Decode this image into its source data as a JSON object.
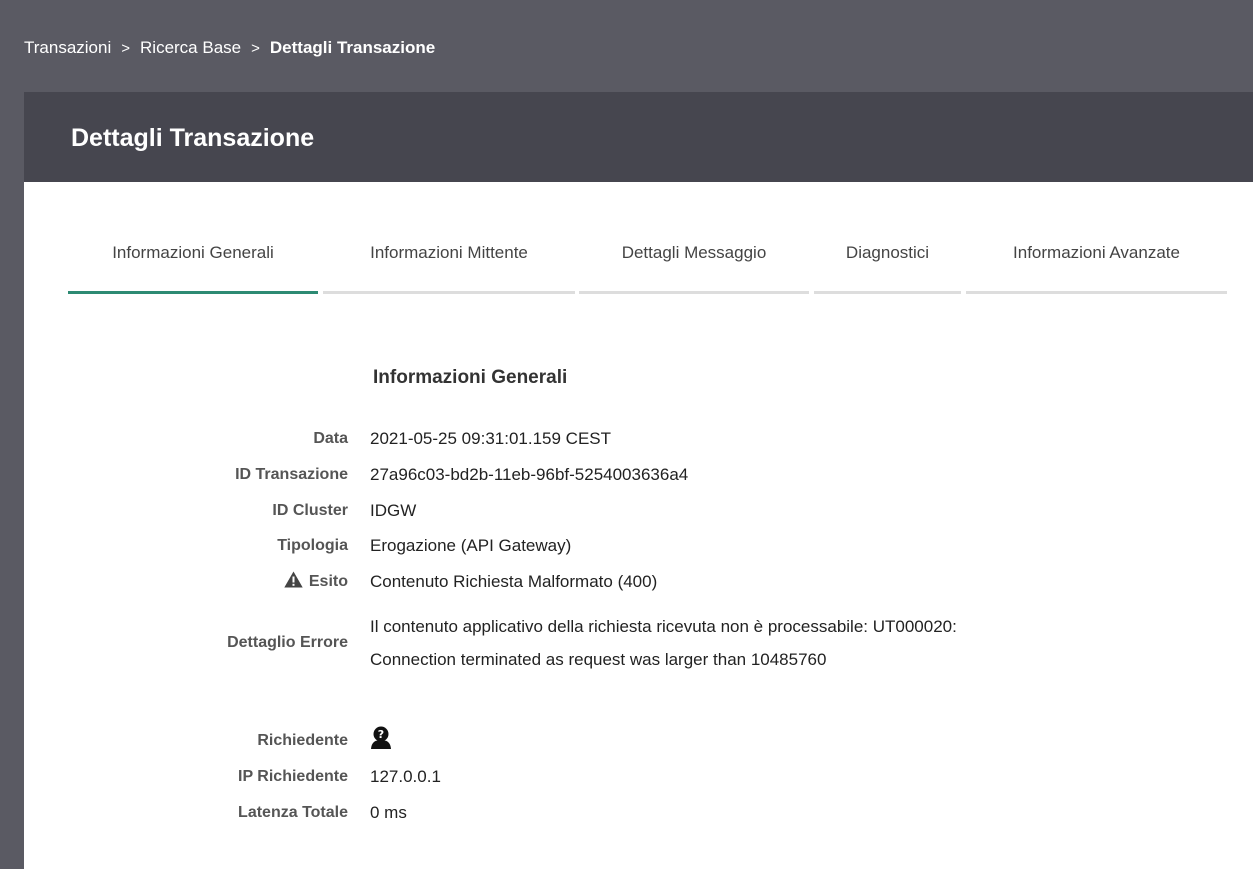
{
  "breadcrumb": {
    "items": [
      "Transazioni",
      "Ricerca Base"
    ],
    "current": "Dettagli Transazione",
    "separator": ">"
  },
  "panel": {
    "title": "Dettagli Transazione"
  },
  "tabs": [
    {
      "label": "Informazioni Generali",
      "active": true
    },
    {
      "label": "Informazioni Mittente",
      "active": false
    },
    {
      "label": "Dettagli Messaggio",
      "active": false
    },
    {
      "label": "Diagnostici",
      "active": false
    },
    {
      "label": "Informazioni Avanzate",
      "active": false
    }
  ],
  "section": {
    "title": "Informazioni Generali",
    "fields": {
      "data": {
        "label": "Data",
        "value": "2021-05-25 09:31:01.159 CEST"
      },
      "id_transazione": {
        "label": "ID Transazione",
        "value": "27a96c03-bd2b-11eb-96bf-5254003636a4"
      },
      "id_cluster": {
        "label": "ID Cluster",
        "value": "IDGW"
      },
      "tipologia": {
        "label": "Tipologia",
        "value": "Erogazione (API Gateway)"
      },
      "esito": {
        "label": "Esito",
        "value": "Contenuto Richiesta Malformato (400)",
        "icon": "warning-icon"
      },
      "dettaglio_errore": {
        "label": "Dettaglio Errore",
        "value_line1": "Il contenuto applicativo della richiesta ricevuta non è processabile: UT000020:",
        "value_line2": "Connection terminated as request was larger than 10485760"
      },
      "richiedente": {
        "label": "Richiedente",
        "icon": "unknown-user-icon"
      },
      "ip_richiedente": {
        "label": "IP Richiedente",
        "value": "127.0.0.1"
      },
      "latenza_totale": {
        "label": "Latenza Totale",
        "value": "0 ms"
      }
    }
  },
  "colors": {
    "topbar": "#5a5a63",
    "panel_header": "#46464f",
    "active_tab_accent": "#2d8a73",
    "inactive_tab_line": "#dddddd"
  }
}
